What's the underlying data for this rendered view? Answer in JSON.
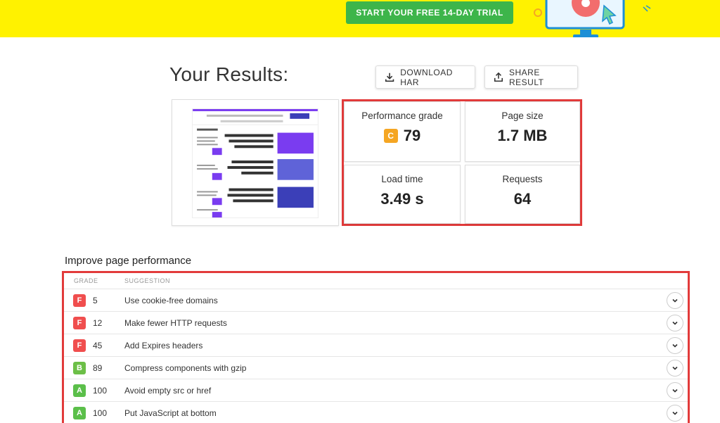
{
  "banner": {
    "cta_label": "START YOUR FREE 14-DAY TRIAL"
  },
  "results": {
    "title": "Your Results:",
    "download_label": "DOWNLOAD HAR",
    "share_label": "SHARE RESULT"
  },
  "stats": {
    "performance": {
      "label": "Performance grade",
      "grade": "C",
      "value": "79"
    },
    "page_size": {
      "label": "Page size",
      "value": "1.7 MB"
    },
    "load_time": {
      "label": "Load time",
      "value": "3.49 s"
    },
    "requests": {
      "label": "Requests",
      "value": "64"
    }
  },
  "improve": {
    "title": "Improve page performance",
    "col_grade": "GRADE",
    "col_suggestion": "SUGGESTION",
    "rows": [
      {
        "grade": "F",
        "score": "5",
        "text": "Use cookie-free domains"
      },
      {
        "grade": "F",
        "score": "12",
        "text": "Make fewer HTTP requests"
      },
      {
        "grade": "F",
        "score": "45",
        "text": "Add Expires headers"
      },
      {
        "grade": "B",
        "score": "89",
        "text": "Compress components with gzip"
      },
      {
        "grade": "A",
        "score": "100",
        "text": "Avoid empty src or href"
      },
      {
        "grade": "A",
        "score": "100",
        "text": "Put JavaScript at bottom"
      }
    ]
  },
  "colors": {
    "banner": "#fff200",
    "cta": "#3db54a",
    "highlight": "#e23b3b",
    "grade_f": "#f04e4e",
    "grade_b": "#6cbf47",
    "grade_a": "#5bbf4a",
    "grade_c": "#f5a623"
  }
}
